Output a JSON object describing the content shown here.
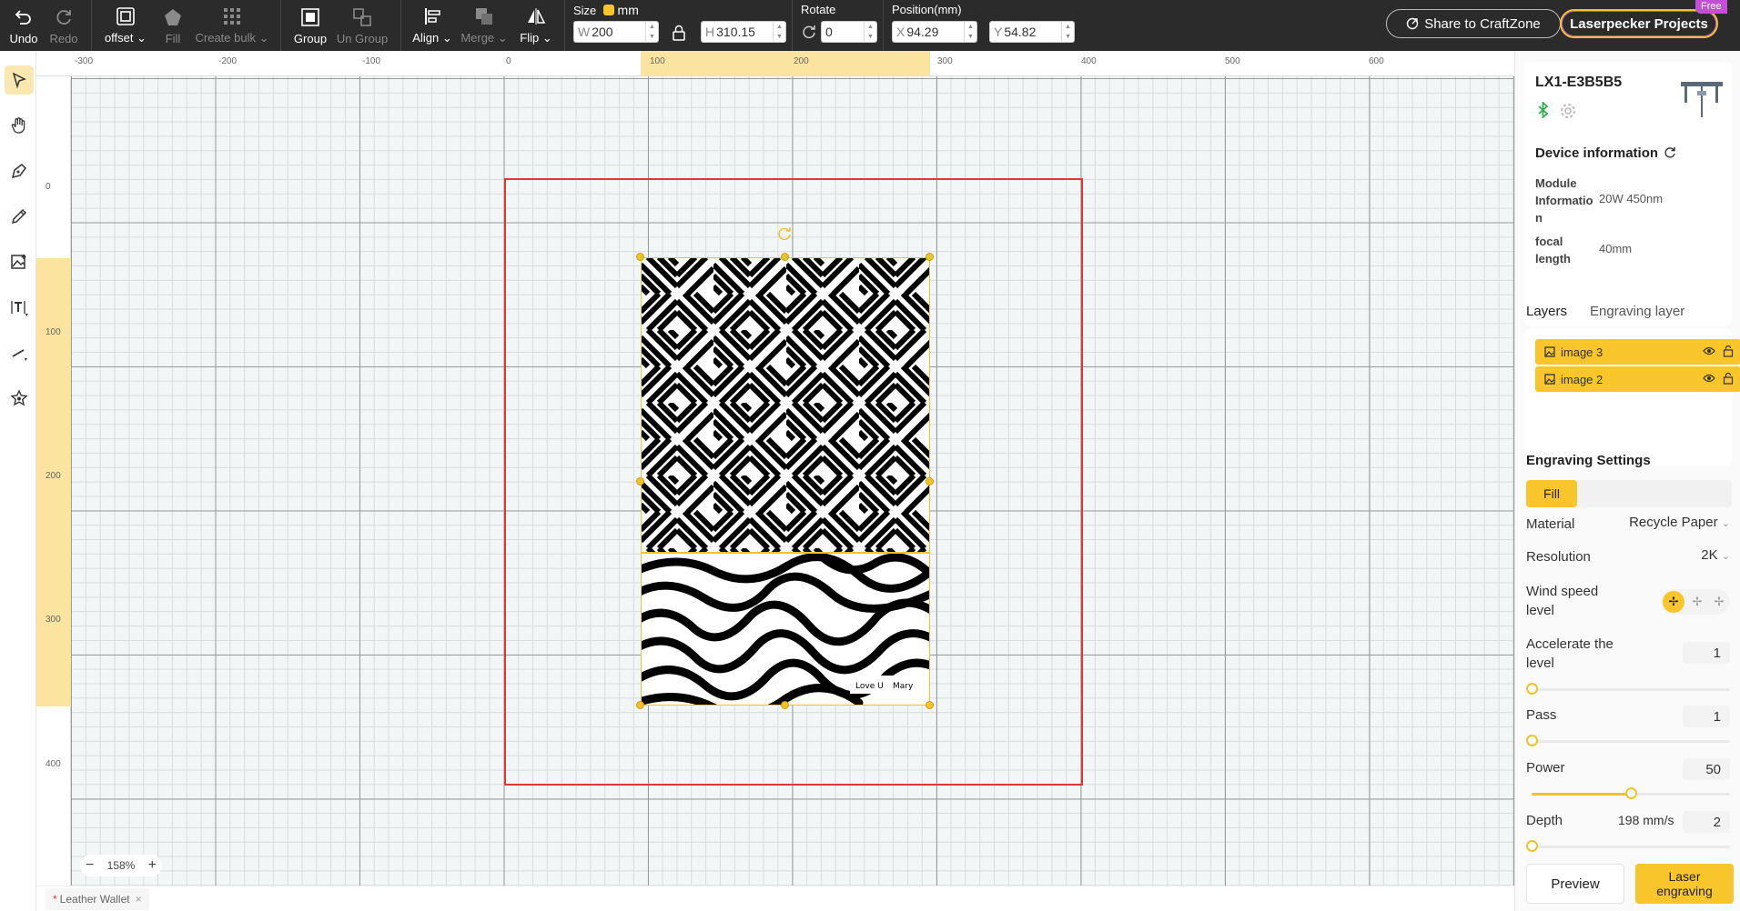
{
  "toolbar": {
    "undo": "Undo",
    "redo": "Redo",
    "offset": "offset",
    "fill": "Fill",
    "create_bulk": "Create bulk",
    "group": "Group",
    "ungroup": "Un Group",
    "align": "Align",
    "merge": "Merge",
    "flip": "Flip",
    "size_label": "Size",
    "unit": "mm",
    "width_prefix": "W",
    "width": "200",
    "height_prefix": "H",
    "height": "310.15",
    "rotate_label": "Rotate",
    "rotate": "0",
    "position_label": "Position(mm)",
    "x_prefix": "X",
    "x": "94.29",
    "y_prefix": "Y",
    "y": "54.82",
    "share": "Share to CraftZone",
    "projects": "Laserpecker Projects",
    "free_badge": "Free"
  },
  "ruler": {
    "top": [
      "-300",
      "-200",
      "-100",
      "0",
      "100",
      "200",
      "300",
      "400",
      "500",
      "600"
    ],
    "left": [
      "0",
      "100",
      "200",
      "300",
      "400"
    ]
  },
  "canvas": {
    "artwork_text": "Love U",
    "artwork_text2": "Mary"
  },
  "zoom": {
    "level": "158%"
  },
  "document_tab": {
    "modified": "*",
    "name": "Leather Wallet"
  },
  "device": {
    "name": "LX1-E3B5B5",
    "info_title": "Device information",
    "module_label": "Module Informatio n",
    "module_value": "20W 450nm",
    "focal_label": "focal length",
    "focal_value": "40mm"
  },
  "layers": {
    "tab_layers": "Layers",
    "tab_engraving": "Engraving layer",
    "items": [
      {
        "name": "image 3"
      },
      {
        "name": "image 2"
      }
    ]
  },
  "engraving": {
    "title": "Engraving Settings",
    "mode": "Fill",
    "material_label": "Material",
    "material": "Recycle Paper",
    "resolution_label": "Resolution",
    "resolution": "2K",
    "wind_label": "Wind speed level",
    "accel_label": "Accelerate the level",
    "accel": "1",
    "accel_fraction": 0,
    "pass_label": "Pass",
    "pass": "1",
    "pass_fraction": 0,
    "power_label": "Power",
    "power": "50",
    "power_fraction": 0.5,
    "depth_label": "Depth",
    "speed": "198 mm/s",
    "depth": "2",
    "depth_fraction": 0,
    "preview": "Preview",
    "laser": "Laser engraving"
  },
  "colors": {
    "accent": "#f8c52b",
    "workarea": "#e23535",
    "toolbar": "#2b2b2b"
  }
}
